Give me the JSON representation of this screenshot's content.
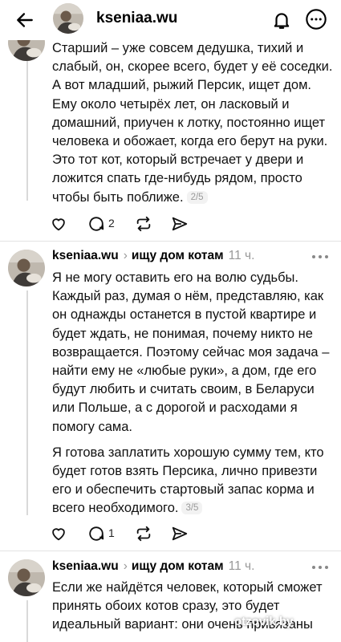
{
  "topbar": {
    "username": "kseniaa.wu",
    "icons": [
      "arrow-left-icon",
      "bell-icon",
      "more-icon"
    ]
  },
  "posts": [
    {
      "paragraphs": [
        "Старший – уже совсем дедушка, тихий и слабый, он, скорее всего, будет у её соседки. А вот младший, рыжий Персик, ищет дом. Ему около четырёх лет, он ласковый и домашний, приучен к лотку, постоянно ищет человека и обожает, когда его берут на руки. Это тот кот, который встречает у двери и ложится спать где-нибудь рядом, просто чтобы быть поближе."
      ],
      "page_indicator": "2/5",
      "reply_count": "2"
    },
    {
      "username": "kseniaa.wu",
      "group": "ищу дом котам",
      "time": "11 ч.",
      "paragraphs": [
        "Я не могу оставить его на волю судьбы. Каждый раз, думая о нём, представляю, как он однажды останется в пустой квартире и будет ждать, не понимая, почему никто не возвращается. Поэтому сейчас моя задача – найти ему не «любые руки», а дом, где его будут любить и считать своим, в Беларуси или Польше, а с дорогой и расходами я помогу сама.",
        "Я готова заплатить хорошую сумму тем, кто будет готов взять Персика, лично привезти его и обеспечить стартовый запас корма и всего необходимого."
      ],
      "page_indicator": "3/5",
      "reply_count": "1"
    },
    {
      "username": "kseniaa.wu",
      "group": "ищу дом котам",
      "time": "11 ч.",
      "paragraphs": [
        "Если же найдётся человек, который сможет принять обоих котов сразу, это будет идеальный вариант: они очень привязаны"
      ]
    }
  ],
  "watermark": "otzovik.by"
}
